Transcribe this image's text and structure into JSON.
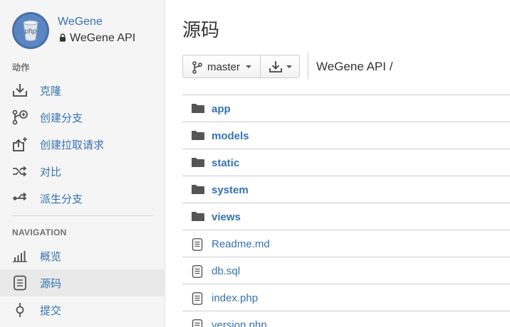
{
  "sidebar": {
    "project_name": "WeGene",
    "repo_name": "WeGene API",
    "avatar_text": "php",
    "actions_title": "动作",
    "actions": [
      {
        "label": "克隆",
        "icon": "clone-download-icon"
      },
      {
        "label": "创建分支",
        "icon": "create-branch-icon"
      },
      {
        "label": "创建拉取请求",
        "icon": "create-pull-request-icon"
      },
      {
        "label": "对比",
        "icon": "compare-shuffle-icon"
      },
      {
        "label": "派生分支",
        "icon": "fork-icon"
      }
    ],
    "navigation_title": "NAVIGATION",
    "navigation": [
      {
        "label": "概览",
        "icon": "overview-bar-chart-icon",
        "active": false
      },
      {
        "label": "源码",
        "icon": "source-file-icon",
        "active": true
      },
      {
        "label": "提交",
        "icon": "commit-icon",
        "active": false
      }
    ]
  },
  "main": {
    "title": "源码",
    "branch": "master",
    "breadcrumb": "WeGene API /",
    "files": [
      {
        "name": "app",
        "type": "directory"
      },
      {
        "name": "models",
        "type": "directory"
      },
      {
        "name": "static",
        "type": "directory"
      },
      {
        "name": "system",
        "type": "directory"
      },
      {
        "name": "views",
        "type": "directory"
      },
      {
        "name": "Readme.md",
        "type": "file"
      },
      {
        "name": "db.sql",
        "type": "file"
      },
      {
        "name": "index.php",
        "type": "file"
      },
      {
        "name": "version.php",
        "type": "file"
      }
    ]
  },
  "colors": {
    "link": "#3572b0",
    "sidebar_bg": "#f5f5f5",
    "active_bg": "#e9e9e9",
    "avatar_ring": "#4a6fa5"
  }
}
